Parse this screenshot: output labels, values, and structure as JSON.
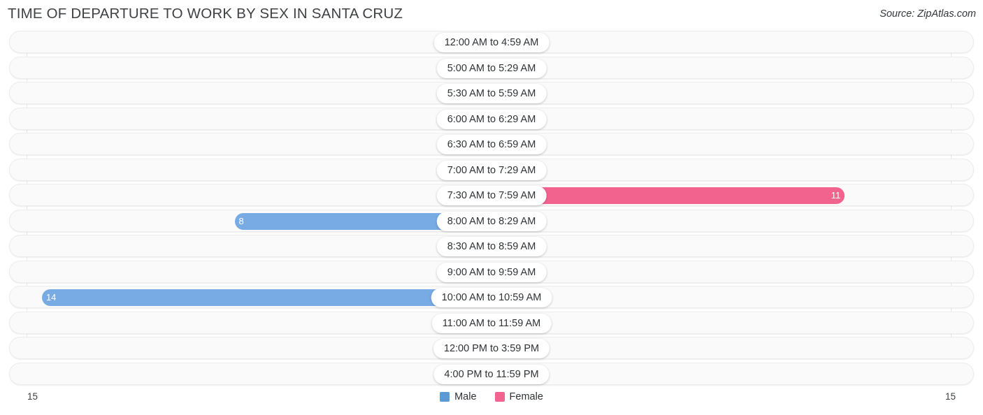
{
  "header": {
    "title": "TIME OF DEPARTURE TO WORK BY SEX IN SANTA CRUZ",
    "source": "Source: ZipAtlas.com"
  },
  "footer": {
    "axis_left": "15",
    "axis_right": "15",
    "legend": [
      {
        "label": "Male",
        "color": "#5b9bd5",
        "icon": "square-swatch"
      },
      {
        "label": "Female",
        "color": "#f2648e",
        "icon": "square-swatch"
      }
    ]
  },
  "colors": {
    "male_pale": "#a9c9ee",
    "male_strong": "#78abe3",
    "female_pale": "#f9abc6",
    "female_strong": "#f2648e",
    "row_bg": "#fafafa",
    "title": "#3f4145"
  },
  "chart_data": {
    "type": "bar",
    "subtype": "diverging-bidirectional-bar",
    "title": "TIME OF DEPARTURE TO WORK BY SEX IN SANTA CRUZ",
    "xlabel": "",
    "ylabel": "",
    "xlim": [
      15,
      0,
      15
    ],
    "axis_max": 15,
    "grid": true,
    "legend_position": "bottom-center",
    "categories": [
      "12:00 AM to 4:59 AM",
      "5:00 AM to 5:29 AM",
      "5:30 AM to 5:59 AM",
      "6:00 AM to 6:29 AM",
      "6:30 AM to 6:59 AM",
      "7:00 AM to 7:29 AM",
      "7:30 AM to 7:59 AM",
      "8:00 AM to 8:29 AM",
      "8:30 AM to 8:59 AM",
      "9:00 AM to 9:59 AM",
      "10:00 AM to 10:59 AM",
      "11:00 AM to 11:59 AM",
      "12:00 PM to 3:59 PM",
      "4:00 PM to 11:59 PM"
    ],
    "series": [
      {
        "name": "Male",
        "direction": "left",
        "values": [
          0,
          0,
          0,
          0,
          0,
          0,
          0,
          8,
          0,
          0,
          14,
          0,
          0,
          0
        ]
      },
      {
        "name": "Female",
        "direction": "right",
        "values": [
          0,
          0,
          0,
          0,
          0,
          0,
          11,
          0,
          0,
          0,
          0,
          0,
          0,
          0
        ]
      }
    ]
  },
  "rows": [
    {
      "label": "12:00 AM to 4:59 AM",
      "male": "0",
      "female": "0"
    },
    {
      "label": "5:00 AM to 5:29 AM",
      "male": "0",
      "female": "0"
    },
    {
      "label": "5:30 AM to 5:59 AM",
      "male": "0",
      "female": "0"
    },
    {
      "label": "6:00 AM to 6:29 AM",
      "male": "0",
      "female": "0"
    },
    {
      "label": "6:30 AM to 6:59 AM",
      "male": "0",
      "female": "0"
    },
    {
      "label": "7:00 AM to 7:29 AM",
      "male": "0",
      "female": "0"
    },
    {
      "label": "7:30 AM to 7:59 AM",
      "male": "0",
      "female": "11"
    },
    {
      "label": "8:00 AM to 8:29 AM",
      "male": "8",
      "female": "0"
    },
    {
      "label": "8:30 AM to 8:59 AM",
      "male": "0",
      "female": "0"
    },
    {
      "label": "9:00 AM to 9:59 AM",
      "male": "0",
      "female": "0"
    },
    {
      "label": "10:00 AM to 10:59 AM",
      "male": "14",
      "female": "0"
    },
    {
      "label": "11:00 AM to 11:59 AM",
      "male": "0",
      "female": "0"
    },
    {
      "label": "12:00 PM to 3:59 PM",
      "male": "0",
      "female": "0"
    },
    {
      "label": "4:00 PM to 11:59 PM",
      "male": "0",
      "female": "0"
    }
  ]
}
